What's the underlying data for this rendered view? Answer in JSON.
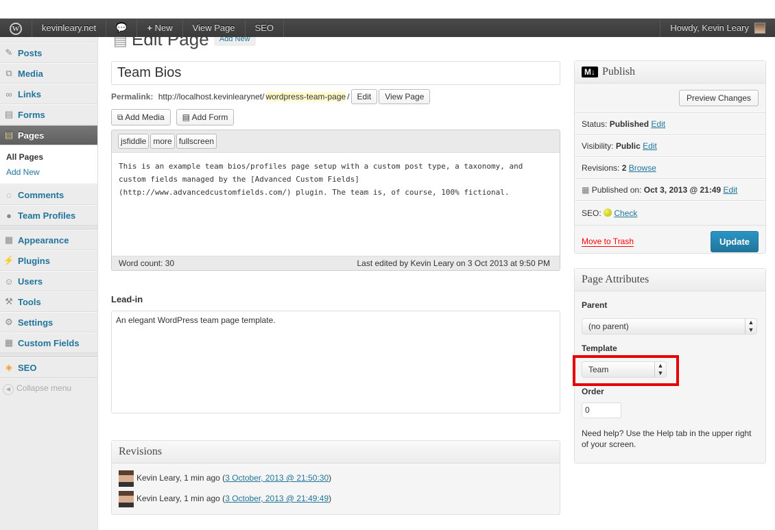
{
  "adminbar": {
    "site": "kevinleary.net",
    "new": "New",
    "view_page": "View Page",
    "seo": "SEO",
    "howdy": "Howdy, Kevin Leary"
  },
  "sidebar": {
    "items": [
      {
        "label": "Posts",
        "icon": "pin-icon"
      },
      {
        "label": "Media",
        "icon": "media-icon"
      },
      {
        "label": "Links",
        "icon": "link-icon"
      },
      {
        "label": "Forms",
        "icon": "forms-icon"
      },
      {
        "label": "Pages",
        "icon": "pages-icon"
      },
      {
        "label": "Comments",
        "icon": "comment-icon"
      },
      {
        "label": "Team Profiles",
        "icon": "person-icon"
      },
      {
        "label": "Appearance",
        "icon": "appearance-icon"
      },
      {
        "label": "Plugins",
        "icon": "plug-icon"
      },
      {
        "label": "Users",
        "icon": "users-icon"
      },
      {
        "label": "Tools",
        "icon": "tools-icon"
      },
      {
        "label": "Settings",
        "icon": "settings-icon"
      },
      {
        "label": "Custom Fields",
        "icon": "custom-fields-icon"
      },
      {
        "label": "SEO",
        "icon": "seo-icon"
      }
    ],
    "submenu": [
      "All Pages",
      "Add New"
    ],
    "collapse": "Collapse menu"
  },
  "header": {
    "title": "Edit Page",
    "add_new": "Add New"
  },
  "post": {
    "title": "Team Bios",
    "permalink_label": "Permalink:",
    "permalink_base": "http://localhost.kevinlearynet/",
    "permalink_slug": "wordpress-team-page",
    "permalink_end": "/",
    "edit": "Edit",
    "view_page": "View Page"
  },
  "media": {
    "add_media": "Add Media",
    "add_form": "Add Form"
  },
  "editor": {
    "buttons": [
      "jsfiddle",
      "more",
      "fullscreen"
    ],
    "content": "This is an example team bios/profiles page setup with a custom post type, a taxonomy, and\ncustom fields managed by the [Advanced Custom Fields]\n(http://www.advancedcustomfields.com/) plugin. The team is, of course, 100% fictional.",
    "word_count": "Word count: 30",
    "last_edited": "Last edited by Kevin Leary on 3 Oct 2013 at 9:50 PM"
  },
  "leadin": {
    "label": "Lead-in",
    "value": "An elegant WordPress team page template."
  },
  "revisions": {
    "title": "Revisions",
    "items": [
      {
        "author": "Kevin Leary, 1 min ago (",
        "link": "3 October, 2013 @ 21:50:30",
        "end": ")"
      },
      {
        "author": "Kevin Leary, 1 min ago (",
        "link": "3 October, 2013 @ 21:49:49",
        "end": ")"
      }
    ]
  },
  "publish": {
    "title": "Publish",
    "preview": "Preview Changes",
    "status_label": "Status:",
    "status": "Published",
    "visibility_label": "Visibility:",
    "visibility": "Public",
    "revisions_label": "Revisions:",
    "revisions": "2",
    "browse": "Browse",
    "published_label": "Published on:",
    "published": "Oct 3, 2013 @ 21:49",
    "seo_label": "SEO:",
    "check": "Check",
    "edit": "Edit",
    "trash": "Move to Trash",
    "update": "Update",
    "md_badge": "M↓"
  },
  "attributes": {
    "title": "Page Attributes",
    "parent_label": "Parent",
    "parent": "(no parent)",
    "template_label": "Template",
    "template": "Team",
    "order_label": "Order",
    "order": "0",
    "help": "Need help? Use the Help tab in the upper right of your screen."
  },
  "colors": {
    "accent": "#21759b",
    "update": "#2a8bbc",
    "highlight": "#e60000"
  }
}
